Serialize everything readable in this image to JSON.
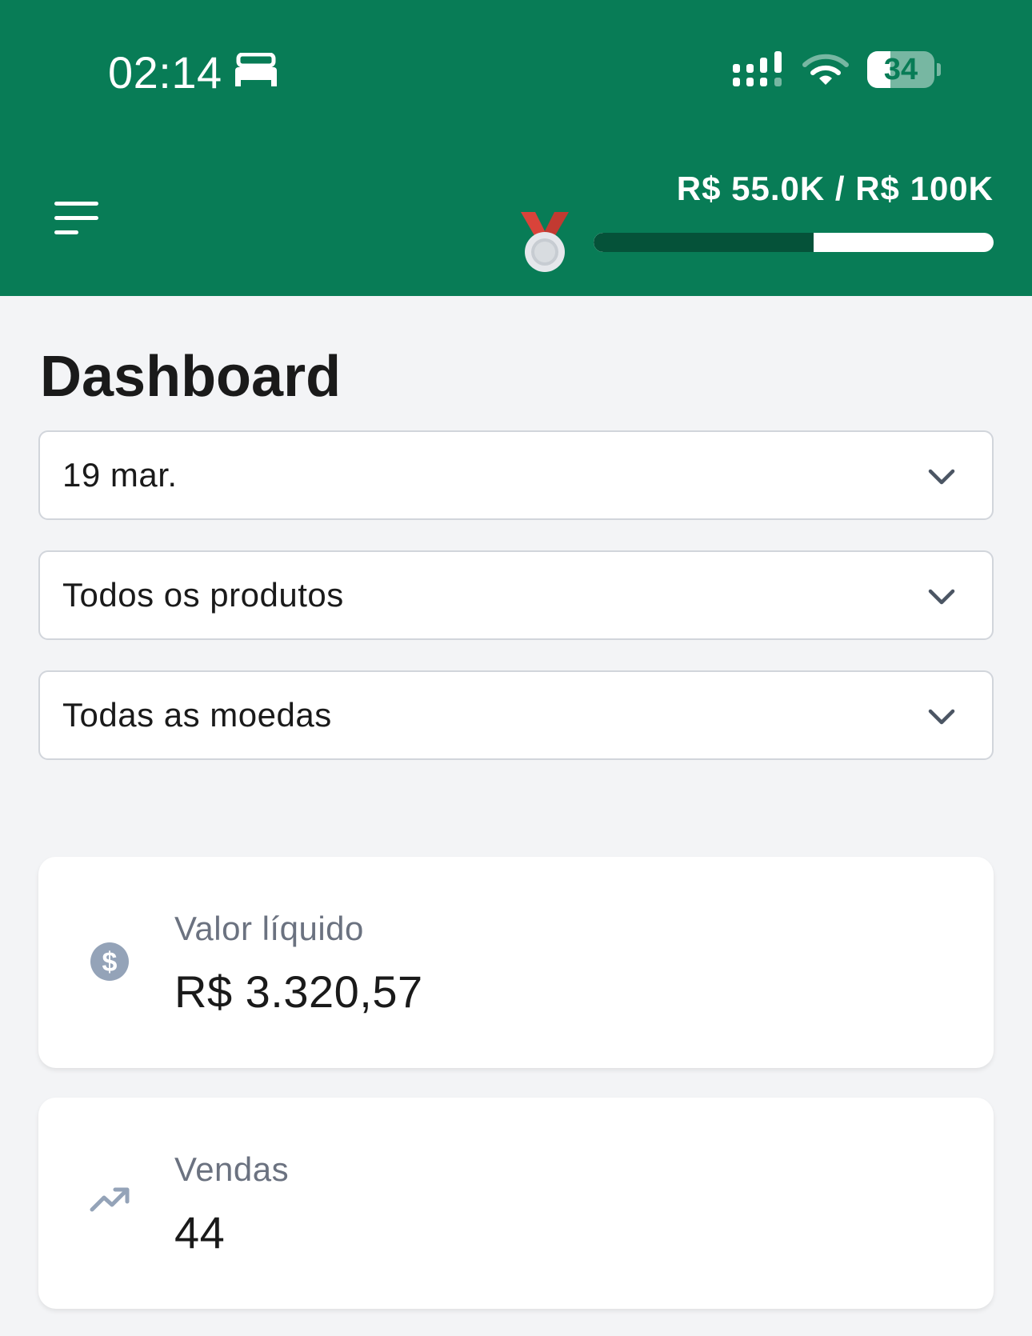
{
  "status_bar": {
    "time": "02:14",
    "battery_level": "34",
    "battery_fraction": 0.34
  },
  "header": {
    "goal_text": "R$ 55.0K / R$ 100K",
    "goal_progress": 0.55
  },
  "page": {
    "title": "Dashboard"
  },
  "filters": {
    "date": "19 mar.",
    "products": "Todos os produtos",
    "currencies": "Todas as moedas"
  },
  "cards": {
    "net_value": {
      "label": "Valor líquido",
      "value": "R$ 3.320,57"
    },
    "sales": {
      "label": "Vendas",
      "value": "44"
    }
  },
  "colors": {
    "brand_green": "#087c56",
    "progress_dark": "#055239",
    "medal_ribbon": "#d9433a",
    "icon_gray": "#94a3b8"
  },
  "icons": {
    "sleep": "bed-icon",
    "signal": "cellular-signal-icon",
    "wifi": "wifi-icon",
    "menu": "menu-icon",
    "medal": "medal-icon",
    "dropdown": "chevron-down-icon",
    "net_value": "dollar-circle-icon",
    "sales": "trending-up-icon"
  }
}
